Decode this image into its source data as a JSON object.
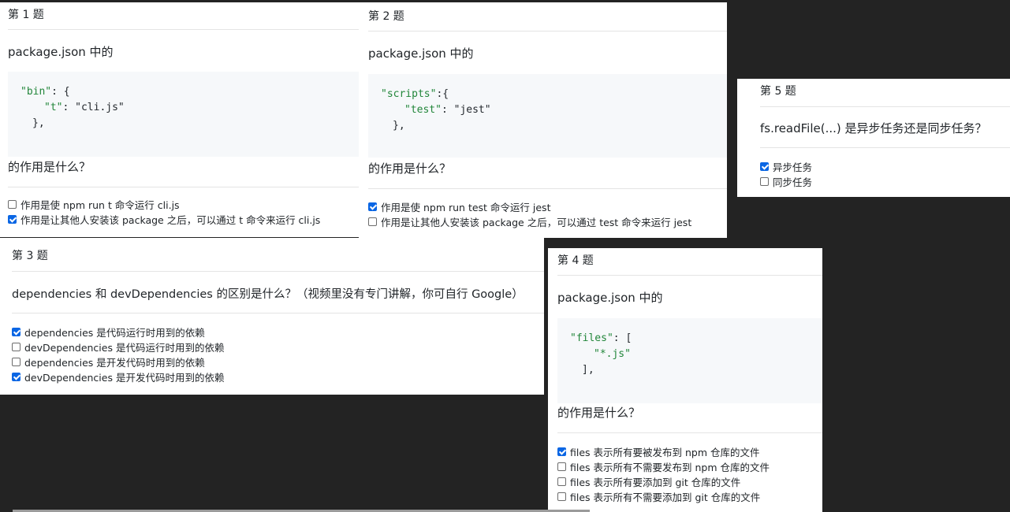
{
  "q1": {
    "title": "第 1 题",
    "prompt": "package.json 中的",
    "code_lines": [
      {
        "key": "\"bin\"",
        "rest": ": {"
      },
      {
        "key": "\"t\"",
        "rest": ": \"cli.js\""
      },
      {
        "key": "",
        "rest": "},"
      }
    ],
    "suffix": "的作用是什么？",
    "options": [
      {
        "label": "作用是使 npm run t 命令运行 cli.js",
        "checked": false
      },
      {
        "label": "作用是让其他人安装该 package 之后，可以通过 t 命令来运行 cli.js",
        "checked": true
      }
    ]
  },
  "q2": {
    "title": "第 2 题",
    "prompt": "package.json 中的",
    "code_lines": [
      {
        "key": "\"scripts\"",
        "rest": ":{"
      },
      {
        "key": "\"test\"",
        "rest": ": \"jest\""
      },
      {
        "key": "",
        "rest": "},"
      }
    ],
    "suffix": "的作用是什么？",
    "options": [
      {
        "label": "作用是使 npm run test 命令运行 jest",
        "checked": true
      },
      {
        "label": "作用是让其他人安装该 package 之后，可以通过 test 命令来运行 jest",
        "checked": false
      }
    ]
  },
  "q3": {
    "title": "第 3 题",
    "prompt": "dependencies 和 devDependencies 的区别是什么？（视频里没有专门讲解，你可自行 Google）",
    "options": [
      {
        "label": "dependencies 是代码运行时用到的依赖",
        "checked": true
      },
      {
        "label": "devDependencies 是代码运行时用到的依赖",
        "checked": false
      },
      {
        "label": "dependencies 是开发代码时用到的依赖",
        "checked": false
      },
      {
        "label": "devDependencies 是开发代码时用到的依赖",
        "checked": true
      }
    ]
  },
  "q4": {
    "title": "第 4 题",
    "prompt": "package.json 中的",
    "code_lines": [
      {
        "key": "\"files\"",
        "rest": ": ["
      },
      {
        "key": "\"*.js\"",
        "rest": ""
      },
      {
        "key": "",
        "rest": "],"
      }
    ],
    "suffix": "的作用是什么？",
    "options": [
      {
        "label": "files 表示所有要被发布到 npm 仓库的文件",
        "checked": true
      },
      {
        "label": "files 表示所有不需要发布到 npm 仓库的文件",
        "checked": false
      },
      {
        "label": "files 表示所有要添加到 git 仓库的文件",
        "checked": false
      },
      {
        "label": "files 表示所有不需要添加到 git 仓库的文件",
        "checked": false
      }
    ]
  },
  "q5": {
    "title": "第 5 题",
    "prompt": "fs.readFile(...) 是异步任务还是同步任务？",
    "options": [
      {
        "label": "异步任务",
        "checked": true
      },
      {
        "label": "同步任务",
        "checked": false
      }
    ]
  }
}
